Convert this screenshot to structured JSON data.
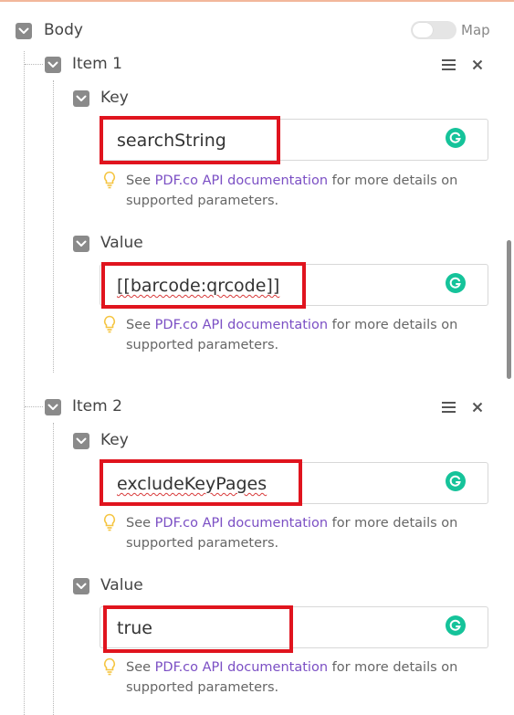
{
  "body": {
    "label": "Body",
    "map_label": "Map",
    "map_enabled": false
  },
  "items": [
    {
      "label": "Item 1",
      "key": {
        "label": "Key",
        "value": "searchString",
        "hint_prefix": "See ",
        "hint_link": "PDF.co API documentation",
        "hint_suffix": " for more details on supported parameters."
      },
      "value": {
        "label": "Value",
        "value": "[[barcode:qrcode]]",
        "hint_prefix": "See ",
        "hint_link": "PDF.co API documentation",
        "hint_suffix": " for more details on supported parameters."
      }
    },
    {
      "label": "Item 2",
      "key": {
        "label": "Key",
        "value": "excludeKeyPages",
        "hint_prefix": "See ",
        "hint_link": "PDF.co API documentation",
        "hint_suffix": " for more details on supported parameters."
      },
      "value": {
        "label": "Value",
        "value": "true",
        "hint_prefix": "See ",
        "hint_link": "PDF.co API documentation",
        "hint_suffix": " for more details on supported parameters."
      }
    }
  ],
  "colors": {
    "highlight": "#e0141e",
    "link": "#7b4fc4",
    "grammarly": "#15c39a",
    "chevron_box": "#8a8a8a"
  },
  "icons": {
    "collapse": "chevron-down-icon",
    "reorder": "hamburger-menu-icon",
    "remove": "close-icon",
    "assistant": "grammarly-icon",
    "hint": "lightbulb-icon"
  }
}
